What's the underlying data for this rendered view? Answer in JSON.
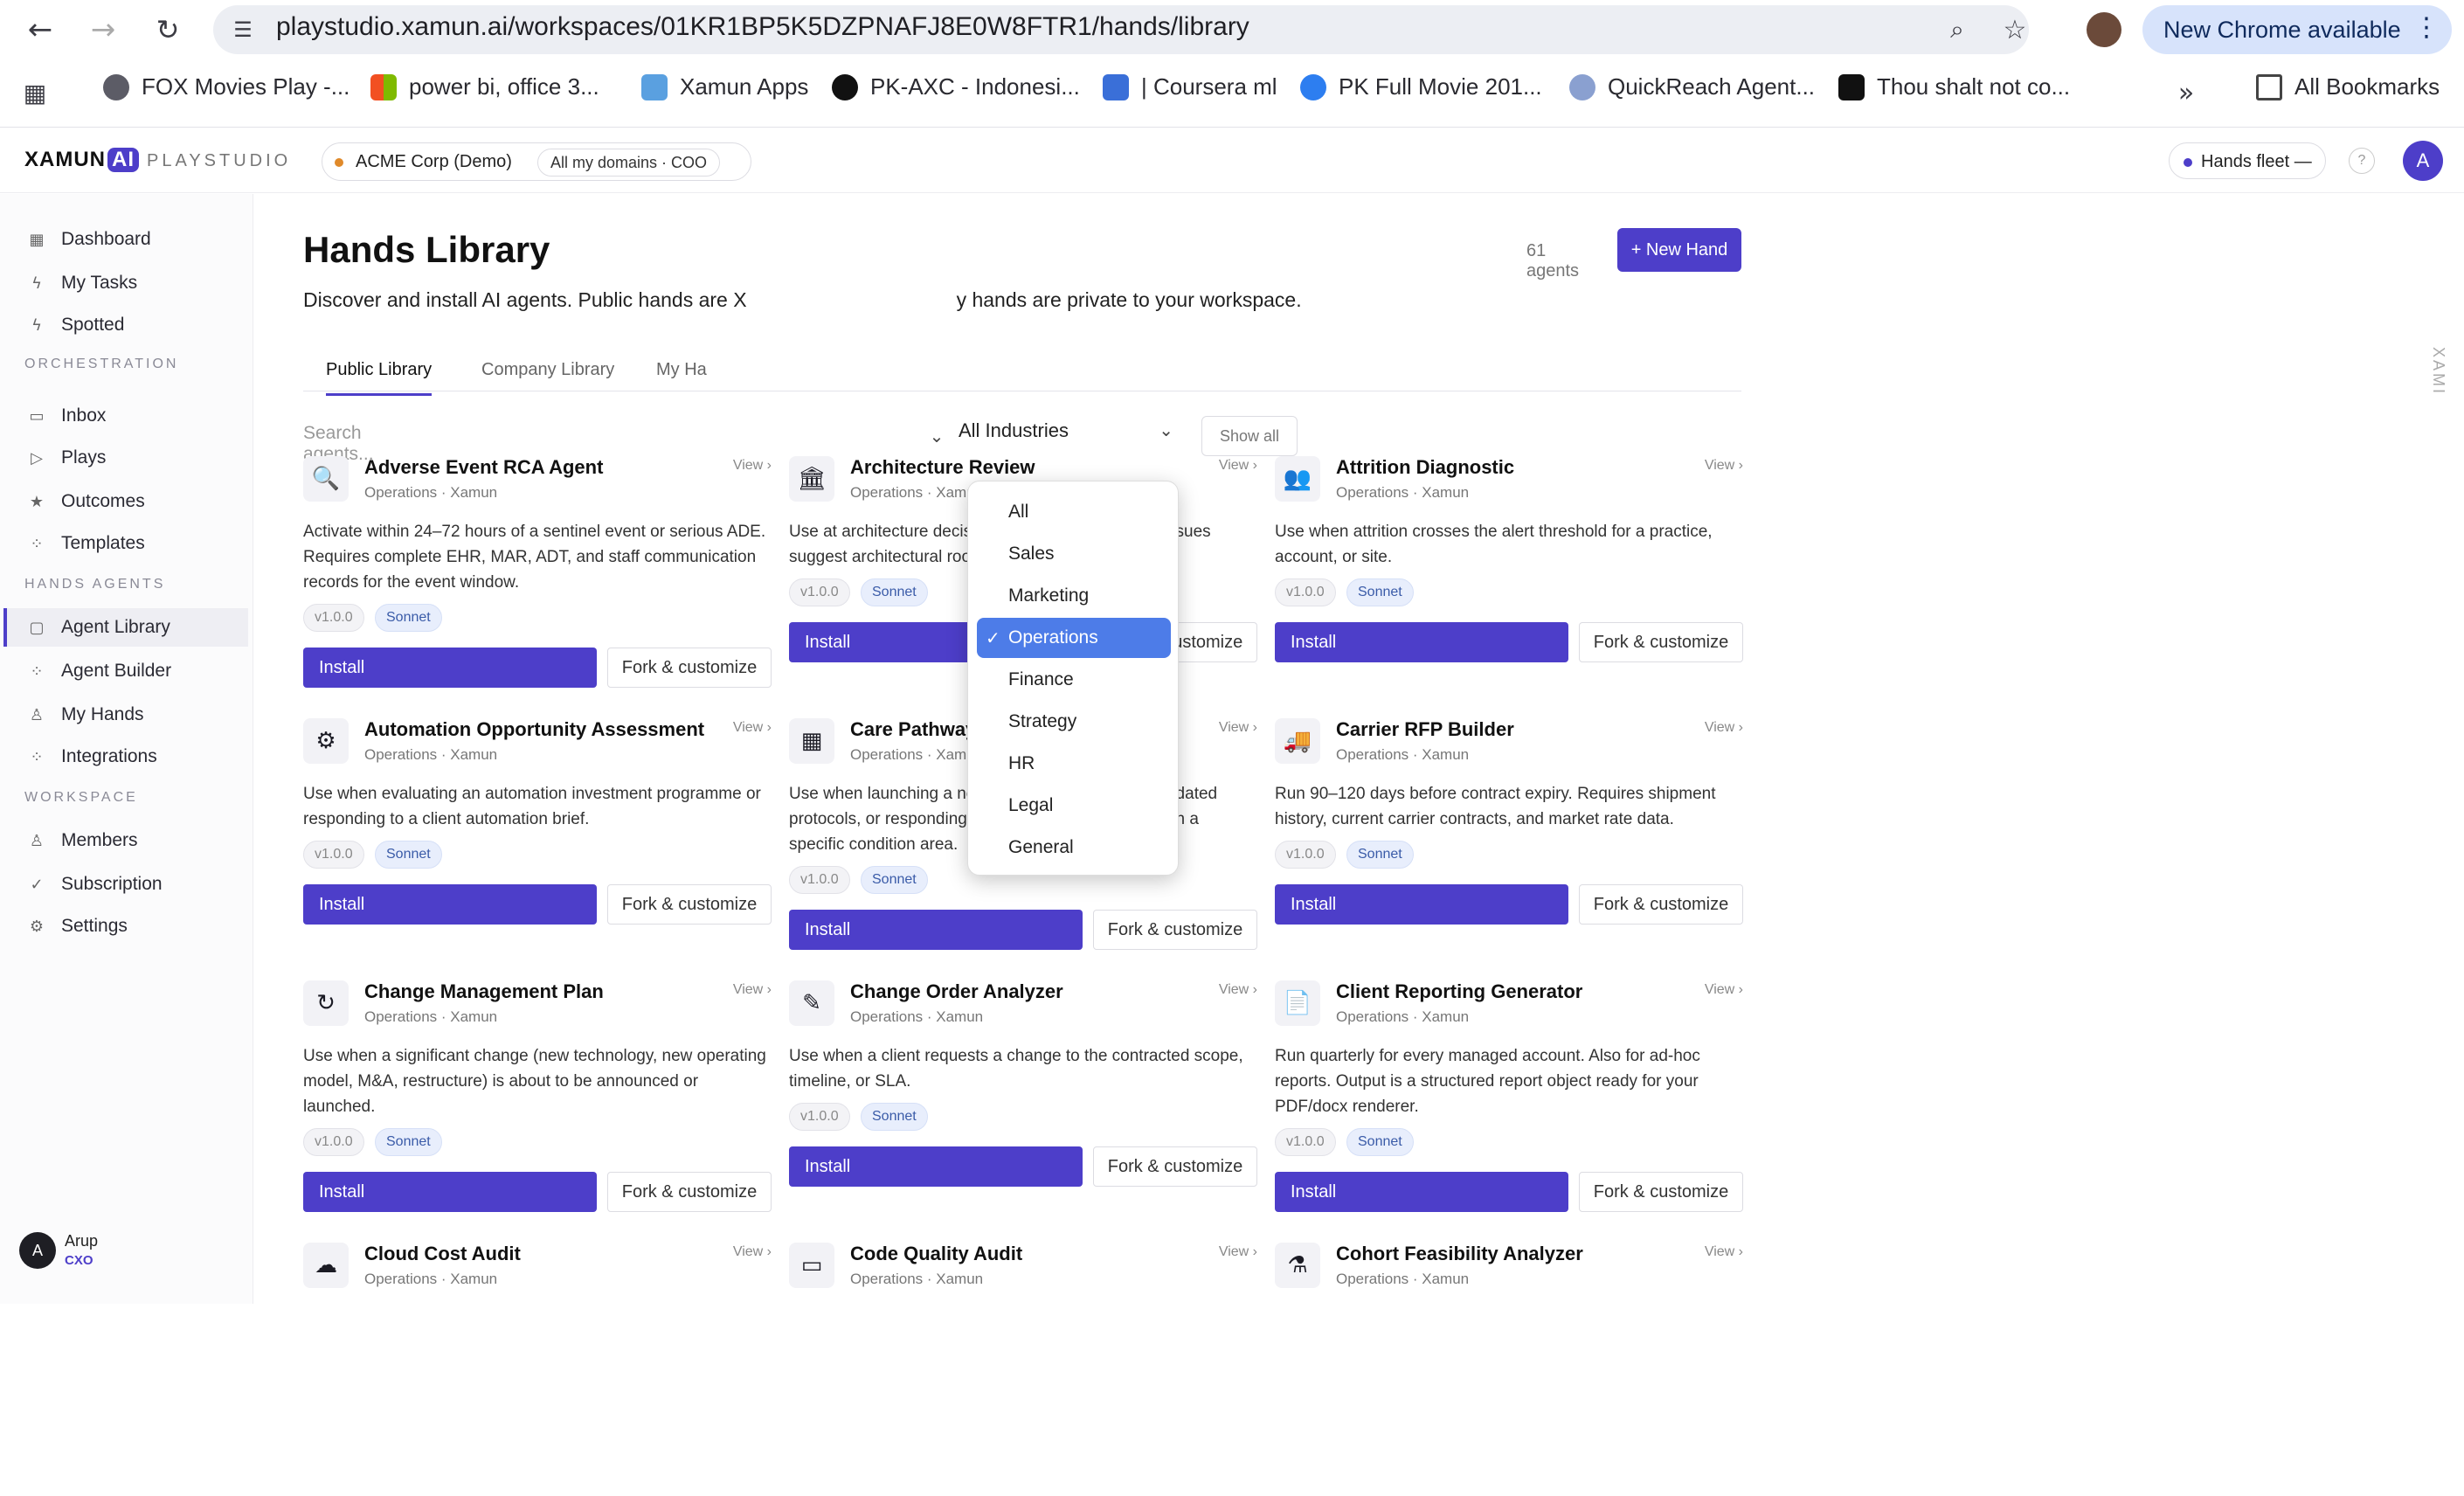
{
  "browser": {
    "url": "playstudio.xamun.ai/workspaces/01KR1BP5K5DZPNAFJ8E0W8FTR1/hands/library",
    "new_chrome": "New Chrome available",
    "bookmarks": [
      "FOX Movies Play -...",
      "power bi, office 3...",
      "Xamun Apps",
      "PK-AXC - Indonesi...",
      "| Coursera ml",
      "PK Full Movie 201...",
      "QuickReach Agent...",
      "Thou shalt not co..."
    ],
    "all_bookmarks": "All Bookmarks"
  },
  "topbar": {
    "brand": "XAMUN",
    "brand_ai": "AI",
    "product": "PLAYSTUDIO",
    "workspace": "ACME Corp (Demo)",
    "domains": "All my domains · COO",
    "fleet": "Hands fleet —",
    "avatar": "A"
  },
  "sidebar": {
    "items": [
      {
        "label": "Dashboard",
        "icon": "grid-icon"
      },
      {
        "label": "My Tasks",
        "icon": "bolt-icon"
      },
      {
        "label": "Spotted",
        "icon": "bolt-icon"
      }
    ],
    "orchestration_label": "ORCHESTRATION",
    "orchestration": [
      {
        "label": "Inbox"
      },
      {
        "label": "Plays"
      },
      {
        "label": "Outcomes"
      },
      {
        "label": "Templates"
      }
    ],
    "hands_label": "HANDS AGENTS",
    "hands": [
      {
        "label": "Agent Library"
      },
      {
        "label": "Agent Builder"
      },
      {
        "label": "My Hands"
      },
      {
        "label": "Integrations"
      }
    ],
    "workspace_label": "WORKSPACE",
    "workspace": [
      {
        "label": "Members"
      },
      {
        "label": "Subscription"
      },
      {
        "label": "Settings"
      }
    ],
    "user": {
      "initial": "A",
      "name": "Arup",
      "role": "CXO"
    }
  },
  "main": {
    "title": "Hands Library",
    "subtitle_a": "Discover and install AI agents. Public hands are X",
    "subtitle_b": "y hands are private to your workspace.",
    "count": "61 agents",
    "new_hand": "+ New Hand",
    "tabs": [
      "Public Library",
      "Company Library",
      "My Ha"
    ],
    "search_placeholder": "Search agents...",
    "industry": "All Industries",
    "show_all": "Show all",
    "view": "View ›",
    "install": "Install",
    "fork": "Fork & customize"
  },
  "cards": [
    {
      "title": "Adverse Event RCA Agent",
      "meta": "Operations · Xamun",
      "desc": "Activate within 24–72 hours of a sentinel event or serious ADE. Requires complete EHR, MAR, ADT, and staff communication records for the event window.",
      "version": "v1.0.0",
      "model": "Sonnet",
      "icon": "🔍"
    },
    {
      "title": "Architecture Review",
      "meta": "Operations · Xamun",
      "desc": "Use at architecture decision points or when quality issues suggest architectural root causes.",
      "version": "v1.0.0",
      "model": "Sonnet",
      "icon": "🏛"
    },
    {
      "title": "Attrition Diagnostic",
      "meta": "Operations · Xamun",
      "desc": "Use when attrition crosses the alert threshold for a practice, account, or site.",
      "version": "v1.0.0",
      "model": "Sonnet",
      "icon": "👥"
    },
    {
      "title": "Automation Opportunity Assessment",
      "meta": "Operations · Xamun",
      "desc": "Use when evaluating an automation investment programme or responding to a client automation brief.",
      "version": "v1.0.0",
      "model": "Sonnet",
      "icon": "⚙"
    },
    {
      "title": "Care Pathway Designer",
      "meta": "Operations · Xamun",
      "desc": "Use when launching a new service line, updating outdated protocols, or responding to quality variance findings in a specific condition area.",
      "version": "v1.0.0",
      "model": "Sonnet",
      "icon": "▦"
    },
    {
      "title": "Carrier RFP Builder",
      "meta": "Operations · Xamun",
      "desc": "Run 90–120 days before contract expiry. Requires shipment history, current carrier contracts, and market rate data.",
      "version": "v1.0.0",
      "model": "Sonnet",
      "icon": "🚚"
    },
    {
      "title": "Change Management Plan",
      "meta": "Operations · Xamun",
      "desc": "Use when a significant change (new technology, new operating model, M&A, restructure) is about to be announced or launched.",
      "version": "v1.0.0",
      "model": "Sonnet",
      "icon": "↻"
    },
    {
      "title": "Change Order Analyzer",
      "meta": "Operations · Xamun",
      "desc": "Use when a client requests a change to the contracted scope, timeline, or SLA.",
      "version": "v1.0.0",
      "model": "Sonnet",
      "icon": "✎"
    },
    {
      "title": "Client Reporting Generator",
      "meta": "Operations · Xamun",
      "desc": "Run quarterly for every managed account. Also for ad-hoc reports. Output is a structured report object ready for your PDF/docx renderer.",
      "version": "v1.0.0",
      "model": "Sonnet",
      "icon": "📄"
    },
    {
      "title": "Cloud Cost Audit",
      "meta": "Operations · Xamun",
      "icon": "☁"
    },
    {
      "title": "Code Quality Audit",
      "meta": "Operations · Xamun",
      "icon": "▭"
    },
    {
      "title": "Cohort Feasibility Analyzer",
      "meta": "Operations · Xamun",
      "icon": "⚗"
    }
  ],
  "dropdown": {
    "options": [
      "All",
      "Sales",
      "Marketing",
      "Operations",
      "Finance",
      "Strategy",
      "HR",
      "Legal",
      "General"
    ],
    "selected": "Operations"
  },
  "right_rail": "XAMI"
}
